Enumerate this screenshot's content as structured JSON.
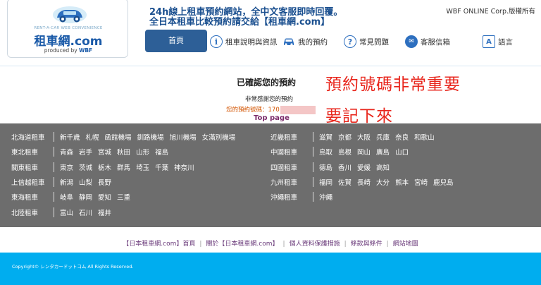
{
  "header": {
    "logo": {
      "tagline_en": "RENT-A-CAR WEB CONVENIENCE",
      "main": "租車網.com",
      "produced_by": "produced by",
      "brand": "WBF"
    },
    "tagline1": "24h線上租車預約網站，全中文客服即時回覆。",
    "tagline2": "全日本租車比較預約請交給【租車網.com】",
    "copyright": "WBF ONLINE Corp.版權所有"
  },
  "nav": {
    "home": "首頁",
    "items": [
      {
        "label": "租車說明與資訊",
        "icon": "info-icon",
        "glyph": "i"
      },
      {
        "label": "我的預約",
        "icon": "car-icon",
        "glyph": "🚗"
      },
      {
        "label": "常見問題",
        "icon": "question-icon",
        "glyph": "?"
      },
      {
        "label": "客服信箱",
        "icon": "mail-icon",
        "glyph": "✉"
      },
      {
        "label": "語言",
        "icon": "language-icon",
        "glyph": "A"
      }
    ]
  },
  "confirmation": {
    "title": "已確認您的預約",
    "thanks": "非常感謝您的預約",
    "booking_label": "您的預約號碼：170",
    "top_page": "Top page"
  },
  "annotation": {
    "line1": "預約號碼非常重要",
    "line2": "要記下來"
  },
  "regions": {
    "left": [
      {
        "name": "北海道租車",
        "cities": [
          "新千歳",
          "札幌",
          "函館機場",
          "釧路機場",
          "旭川機場",
          "女滿別機場"
        ]
      },
      {
        "name": "東北租車",
        "cities": [
          "青森",
          "岩手",
          "宮城",
          "秋田",
          "山形",
          "福島"
        ]
      },
      {
        "name": "關東租車",
        "cities": [
          "東京",
          "茨城",
          "栃木",
          "群馬",
          "埼玉",
          "千葉",
          "神奈川"
        ]
      },
      {
        "name": "上信越租車",
        "cities": [
          "新潟",
          "山梨",
          "長野"
        ]
      },
      {
        "name": "東海租車",
        "cities": [
          "岐阜",
          "静岡",
          "愛知",
          "三重"
        ]
      },
      {
        "name": "北陸租車",
        "cities": [
          "富山",
          "石川",
          "福井"
        ]
      }
    ],
    "right": [
      {
        "name": "近畿租車",
        "cities": [
          "滋賀",
          "京都",
          "大阪",
          "兵庫",
          "奈良",
          "和歌山"
        ]
      },
      {
        "name": "中國租車",
        "cities": [
          "鳥取",
          "島根",
          "岡山",
          "廣島",
          "山口"
        ]
      },
      {
        "name": "四國租車",
        "cities": [
          "德島",
          "香川",
          "愛媛",
          "高知"
        ]
      },
      {
        "name": "九州租車",
        "cities": [
          "福岡",
          "佐賀",
          "長崎",
          "大分",
          "熊本",
          "宮崎",
          "鹿兒島"
        ]
      },
      {
        "name": "沖繩租車",
        "cities": [
          "沖繩"
        ]
      }
    ]
  },
  "footer": {
    "links": [
      "【日本租車網.com】首頁",
      "關於【日本租車網.com】",
      "個人資料保護措施",
      "條款與條件",
      "網站地圖"
    ],
    "copyright": "Copyright© レンタカードットコム All Rights Reserved."
  },
  "colors": {
    "nav_active": "#2d5f97",
    "region_bg": "#6d6d6d",
    "footer_bar": "#00adef",
    "annotation": "#e8261c",
    "booking_number": "#d35400"
  }
}
